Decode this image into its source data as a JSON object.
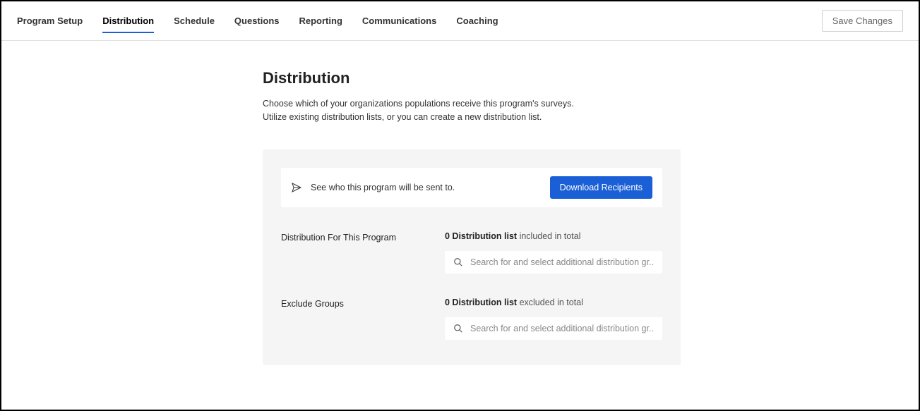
{
  "tabs": [
    {
      "label": "Program Setup",
      "active": false
    },
    {
      "label": "Distribution",
      "active": true
    },
    {
      "label": "Schedule",
      "active": false
    },
    {
      "label": "Questions",
      "active": false
    },
    {
      "label": "Reporting",
      "active": false
    },
    {
      "label": "Communications",
      "active": false
    },
    {
      "label": "Coaching",
      "active": false
    }
  ],
  "save_button": "Save Changes",
  "page": {
    "title": "Distribution",
    "description_line1": "Choose which of your organizations populations receive this program's surveys.",
    "description_line2": "Utilize existing distribution lists, or you can create a new distribution list."
  },
  "notice": {
    "text": "See who this program will be sent to.",
    "download_label": "Download Recipients"
  },
  "distribution_section": {
    "label": "Distribution For This Program",
    "count_bold": "0 Distribution list",
    "count_rest": " included in total",
    "search_placeholder": "Search for and select additional distribution gr..."
  },
  "exclude_section": {
    "label": "Exclude Groups",
    "count_bold": "0 Distribution list",
    "count_rest": " excluded in total",
    "search_placeholder": "Search for and select additional distribution gr..."
  }
}
